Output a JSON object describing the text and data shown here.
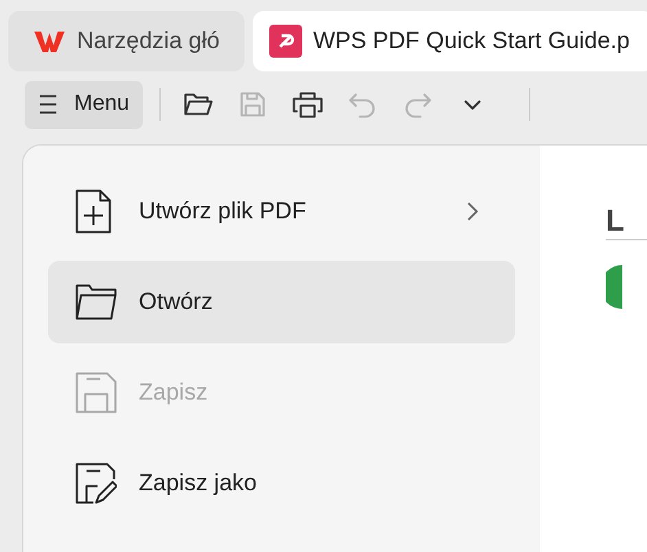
{
  "tabs": [
    {
      "label": "Narzędzia głó",
      "selected": false
    },
    {
      "label": "WPS PDF Quick Start Guide.p",
      "selected": true
    }
  ],
  "toolbar": {
    "menu_button": "Menu",
    "items": [
      {
        "disabled": false
      },
      {
        "disabled": true
      },
      {
        "disabled": false
      },
      {
        "disabled": true
      },
      {
        "disabled": true
      },
      {
        "disabled": false
      }
    ]
  },
  "menu": {
    "items": [
      {
        "label": "Utwórz plik PDF",
        "selected": false,
        "disabled": false,
        "submenu": true
      },
      {
        "label": "Otwórz",
        "selected": true,
        "disabled": false,
        "submenu": false
      },
      {
        "label": "Zapisz",
        "selected": false,
        "disabled": true,
        "submenu": false
      },
      {
        "label": "Zapisz jako",
        "selected": false,
        "disabled": false,
        "submenu": false
      }
    ]
  },
  "document": {
    "heading": "L"
  }
}
